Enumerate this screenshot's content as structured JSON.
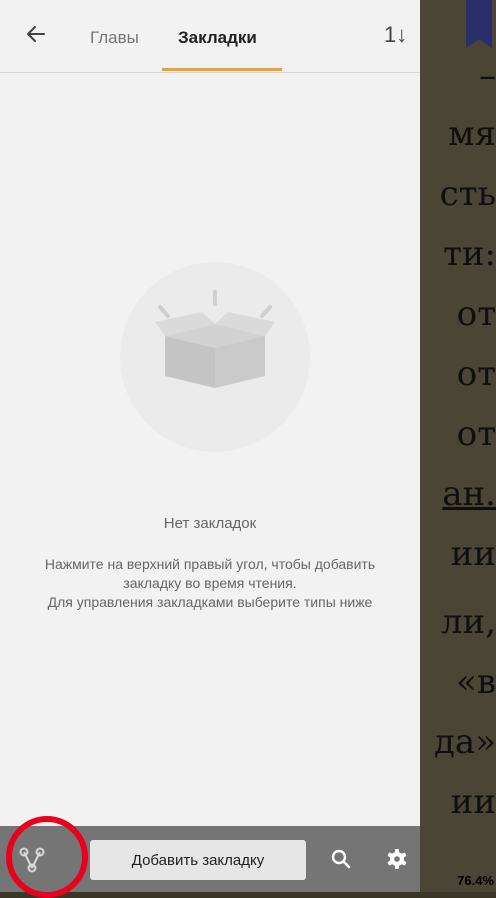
{
  "header": {
    "tabs": [
      {
        "label": "Главы",
        "active": false
      },
      {
        "label": "Закладки",
        "active": true
      }
    ],
    "sort_glyph": "1↓"
  },
  "empty_state": {
    "title": "Нет закладок",
    "description_lines": [
      "Нажмите на верхний правый угол, чтобы добавить",
      "закладку во время чтения.",
      "Для управления закладками выберите типы ниже"
    ],
    "icon": "open-box-icon"
  },
  "bottom_bar": {
    "add_bookmark_label": "Добавить закладку",
    "icons": [
      "share-icon",
      "search-icon",
      "gear-icon"
    ]
  },
  "book_background": {
    "lines": [
      "–",
      "мя",
      "сть",
      "ти:",
      "от",
      "от",
      "от",
      "ан.",
      "ии",
      "ли,",
      "«в",
      "да»",
      "ии"
    ],
    "progress_label": "76.4%"
  },
  "colors": {
    "accent": "#f0a030",
    "highlight_ring": "#e8001c",
    "bottom_bar": "#757575"
  }
}
